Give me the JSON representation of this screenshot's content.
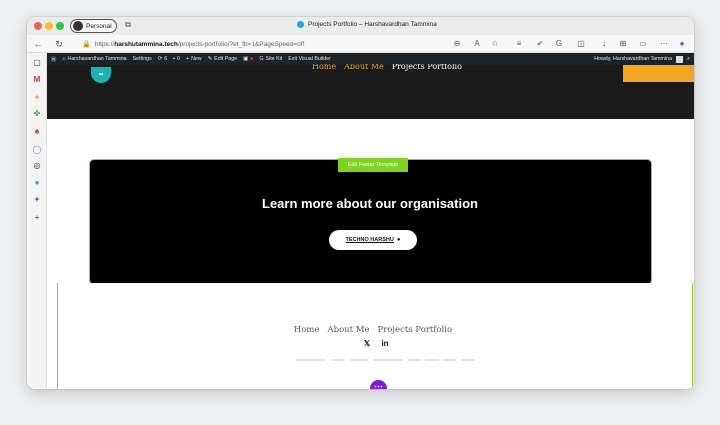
{
  "browser": {
    "profile_label": "Personal",
    "tab_title": "Projects Portfolio – Harshavardhan Tammina",
    "url_prefix": "https://",
    "url_domain": "harshutammina.tech",
    "url_path": "/projects-portfolio/?et_fb=1&PageSpeed=off",
    "tab_favicon_color": "#20a8d8"
  },
  "toolbar_icons": [
    "back-icon",
    "reload-icon",
    "lock-icon",
    "zoom-icon",
    "read-aloud-icon",
    "favorite-icon",
    "extension-icon",
    "checkmark-icon",
    "copilot-icon",
    "split-screen-icon",
    "downloads-icon",
    "collections-icon",
    "screenshot-icon",
    "more-icon",
    "edge-icon"
  ],
  "sidebar_icons": [
    "tabs-icon",
    "gmail-icon",
    "star-icon",
    "games-icon",
    "tree-icon",
    "shield-icon",
    "github-icon",
    "dot-icon",
    "sparkle-icon",
    "add-icon"
  ],
  "admin_bar": {
    "site_name": "Harshavardhan Tammina",
    "settings": "Settings",
    "updates_count": "6",
    "comments_count": "0",
    "new_label": "New",
    "edit_page": "Edit Page",
    "site_kit": "Site Kit",
    "exit_builder": "Exit Visual Builder",
    "howdy": "Howdy, Harshavardhan Tammina"
  },
  "header": {
    "nav_items": [
      "Home",
      "About Me",
      "Projects Portfolio"
    ]
  },
  "footer_cta": {
    "edit_tab_label": "Edit Footer Template",
    "heading": "Learn more about our organisation",
    "button_label": "TECHNO HARSHU",
    "accent_color": "#7ed321"
  },
  "lower_footer": {
    "nav_items": [
      "Home",
      "About Me",
      "Projects Portfolio"
    ],
    "social_icons": [
      "x-icon",
      "linkedin-icon"
    ],
    "more_button_color": "#7a1fd6"
  }
}
